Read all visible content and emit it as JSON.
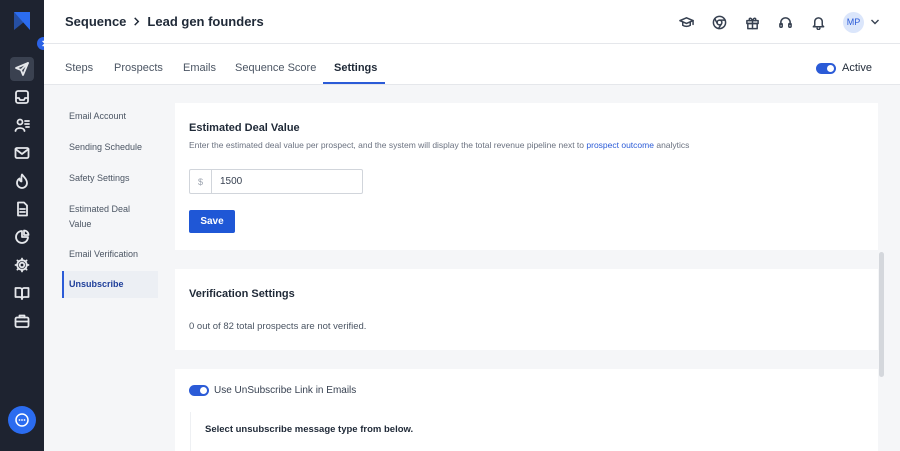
{
  "header": {
    "section": "Sequence",
    "title": "Lead gen founders",
    "avatar_initials": "MP",
    "icons": [
      "graduation-cap-icon",
      "chrome-icon",
      "gift-icon",
      "headset-icon",
      "bell-icon"
    ]
  },
  "tabs": [
    {
      "label": "Steps"
    },
    {
      "label": "Prospects"
    },
    {
      "label": "Emails"
    },
    {
      "label": "Sequence Score"
    },
    {
      "label": "Settings"
    }
  ],
  "status": {
    "label": "Active",
    "enabled": true
  },
  "settings_nav": [
    {
      "label": "Email Account"
    },
    {
      "label": "Sending Schedule"
    },
    {
      "label": "Safety Settings"
    },
    {
      "label": "Estimated Deal Value"
    },
    {
      "label": "Email Verification"
    },
    {
      "label": "Unsubscribe"
    }
  ],
  "deal_value": {
    "title": "Estimated Deal Value",
    "description": "Enter the estimated deal value per prospect, and the system will display the total revenue pipeline next to",
    "link_text": "prospect outcome",
    "description_suffix": "analytics",
    "currency_symbol": "$",
    "value": "1500",
    "save_label": "Save"
  },
  "verification": {
    "title": "Verification Settings",
    "status_text": "0 out of 82 total prospects are not verified."
  },
  "unsubscribe": {
    "toggle_label": "Use UnSubscribe Link in Emails",
    "enabled": true,
    "message_type_title": "Select unsubscribe message type from below."
  },
  "colors": {
    "accent": "#2b5bd7",
    "rail": "#1e2330",
    "background": "#f5f6f8"
  }
}
